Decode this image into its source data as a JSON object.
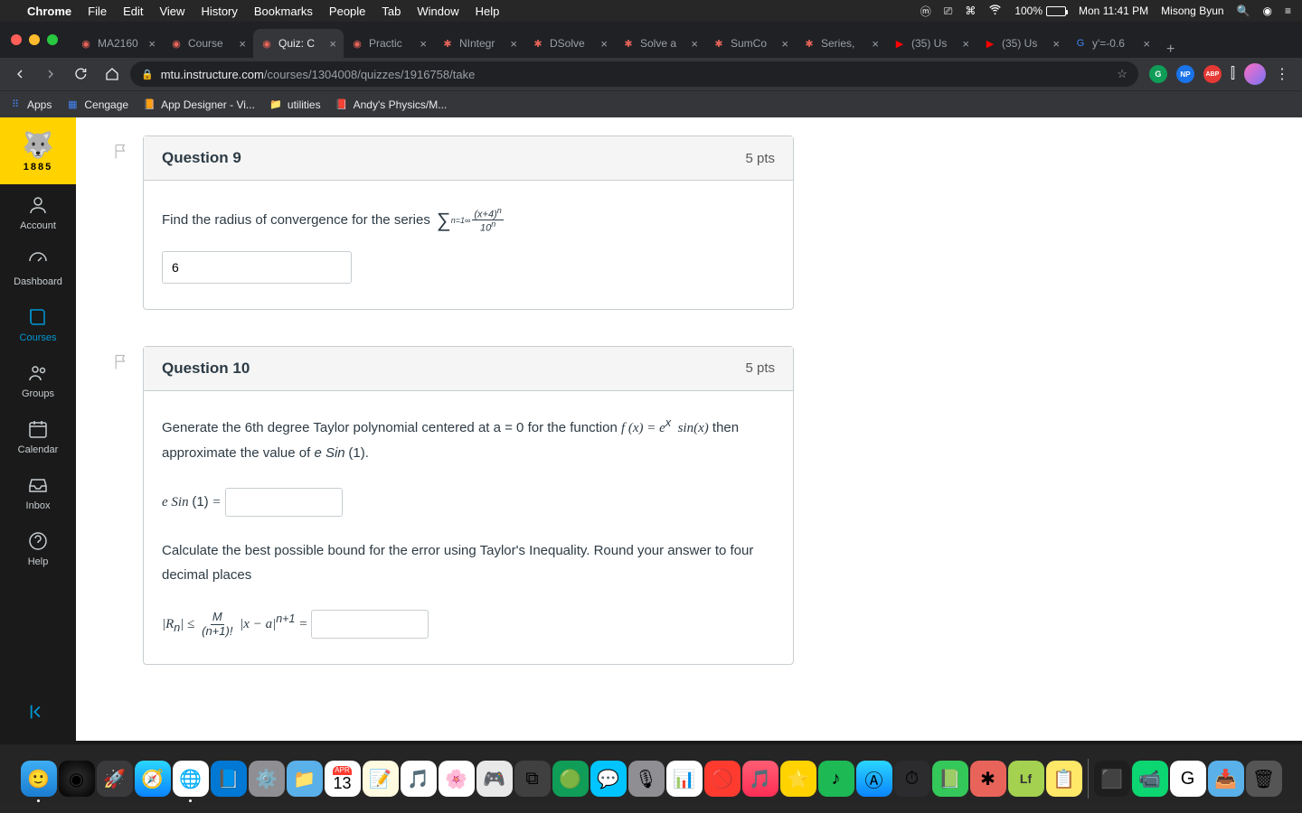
{
  "menubar": {
    "app": "Chrome",
    "items": [
      "File",
      "Edit",
      "View",
      "History",
      "Bookmarks",
      "People",
      "Tab",
      "Window",
      "Help"
    ],
    "battery": "100%",
    "clock": "Mon 11:41 PM",
    "user": "Misong Byun"
  },
  "tabs": [
    {
      "title": "MA2160",
      "favicon": "canvas"
    },
    {
      "title": "Course",
      "favicon": "canvas"
    },
    {
      "title": "Quiz: C",
      "favicon": "canvas",
      "active": true
    },
    {
      "title": "Practic",
      "favicon": "canvas"
    },
    {
      "title": "NIntegr",
      "favicon": "gear"
    },
    {
      "title": "DSolve",
      "favicon": "gear"
    },
    {
      "title": "Solve a",
      "favicon": "gear"
    },
    {
      "title": "SumCo",
      "favicon": "gear"
    },
    {
      "title": "Series,",
      "favicon": "gear"
    },
    {
      "title": "(35) Us",
      "favicon": "yt"
    },
    {
      "title": "(35) Us",
      "favicon": "yt"
    },
    {
      "title": "y'=-0.6",
      "favicon": "g"
    }
  ],
  "addr": {
    "host": "mtu.instructure.com",
    "path": "/courses/1304008/quizzes/1916758/take"
  },
  "ext": {
    "np": "NP",
    "abp": "ABP"
  },
  "bookmarks": [
    {
      "label": "Apps",
      "icon": "⠿"
    },
    {
      "label": "Cengage",
      "icon": "▦"
    },
    {
      "label": "App Designer - Vi...",
      "icon": "📙"
    },
    {
      "label": "utilities",
      "icon": "📁"
    },
    {
      "label": "Andy's Physics/M...",
      "icon": "📕"
    }
  ],
  "canvasLogo": {
    "year": "1885"
  },
  "canvasNav": [
    {
      "label": "Account",
      "icon": "user"
    },
    {
      "label": "Dashboard",
      "icon": "dash"
    },
    {
      "label": "Courses",
      "icon": "book",
      "active": true
    },
    {
      "label": "Groups",
      "icon": "group"
    },
    {
      "label": "Calendar",
      "icon": "cal"
    },
    {
      "label": "Inbox",
      "icon": "inbox"
    },
    {
      "label": "Help",
      "icon": "help"
    }
  ],
  "q9": {
    "title": "Question 9",
    "pts": "5 pts",
    "prompt": "Find the radius of convergence for the series ",
    "answer": "6"
  },
  "q10": {
    "title": "Question 10",
    "pts": "5 pts",
    "line1a": "Generate the 6th degree Taylor polynomial centered at a = 0 for the function ",
    "line1b": " then approximate the value of ",
    "eSin": "e Sin",
    "one": "(1)",
    "dot": ".",
    "eSinEq": "e Sin (1) = ",
    "line3": "Calculate the best possible bound for the error using Taylor's Inequality. Round your answer to four decimal places"
  },
  "dockCal": {
    "month": "APR",
    "day": "13"
  },
  "dockLf": "Lf"
}
